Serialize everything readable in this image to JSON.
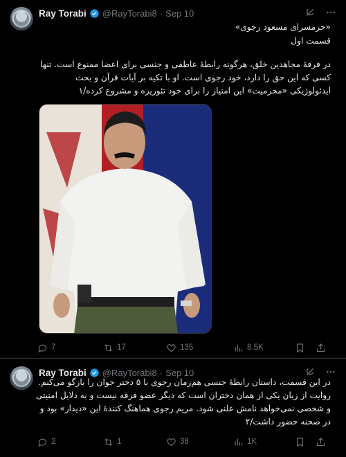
{
  "tweets": [
    {
      "author": {
        "name": "Ray Torabi",
        "handle": "@RayTorabi8",
        "date": "Sep 10"
      },
      "separator": "·",
      "title_line1": "«حرمسرای مسعود رجوی»",
      "title_line2": "قسمت اول",
      "body": "در فرقهٔ مجاهدین خلق، هرگونه رابطهٔ عاطفی و جنسی برای اعضا ممنوع است. تنها کسی که این حق را دارد، خود رجوی است. او با تکیه بر آیات قرآن و بحث ایدئولوژیکی «محرمیت» این امتیاز را برای خود تئوریزه و مشروع کرده/۱",
      "stats": {
        "replies": "7",
        "reposts": "17",
        "likes": "135",
        "views": "8.5K"
      }
    },
    {
      "author": {
        "name": "Ray Torabi",
        "handle": "@RayTorabi8",
        "date": "Sep 10"
      },
      "separator": "·",
      "body": "در این قسمت، داستان رابطهٔ جنسی هم‌زمان رجوی با ۵ دختر جوان را بازگو می‌کنم. روایت از زبان یکی از همان دختران است که دیگر عضو فرقه نیست و به دلایل امنیتی و شخصی نمی‌خواهد نامش علنی شود. مریم رجوی هماهنگ کنندهٔ این «دیدار» بود و در صحنه حضور داشت/۲",
      "stats": {
        "replies": "2",
        "reposts": "1",
        "likes": "38",
        "views": "1K"
      }
    }
  ],
  "colors": {
    "background": "#000000",
    "text": "#e7e9ea",
    "muted": "#71767b",
    "verified": "#1d9bf0",
    "divider": "#2f3336"
  },
  "icons": [
    "grok-icon",
    "more-icon",
    "reply-icon",
    "repost-icon",
    "like-icon",
    "views-icon",
    "bookmark-icon",
    "share-icon",
    "verified-badge-icon"
  ]
}
